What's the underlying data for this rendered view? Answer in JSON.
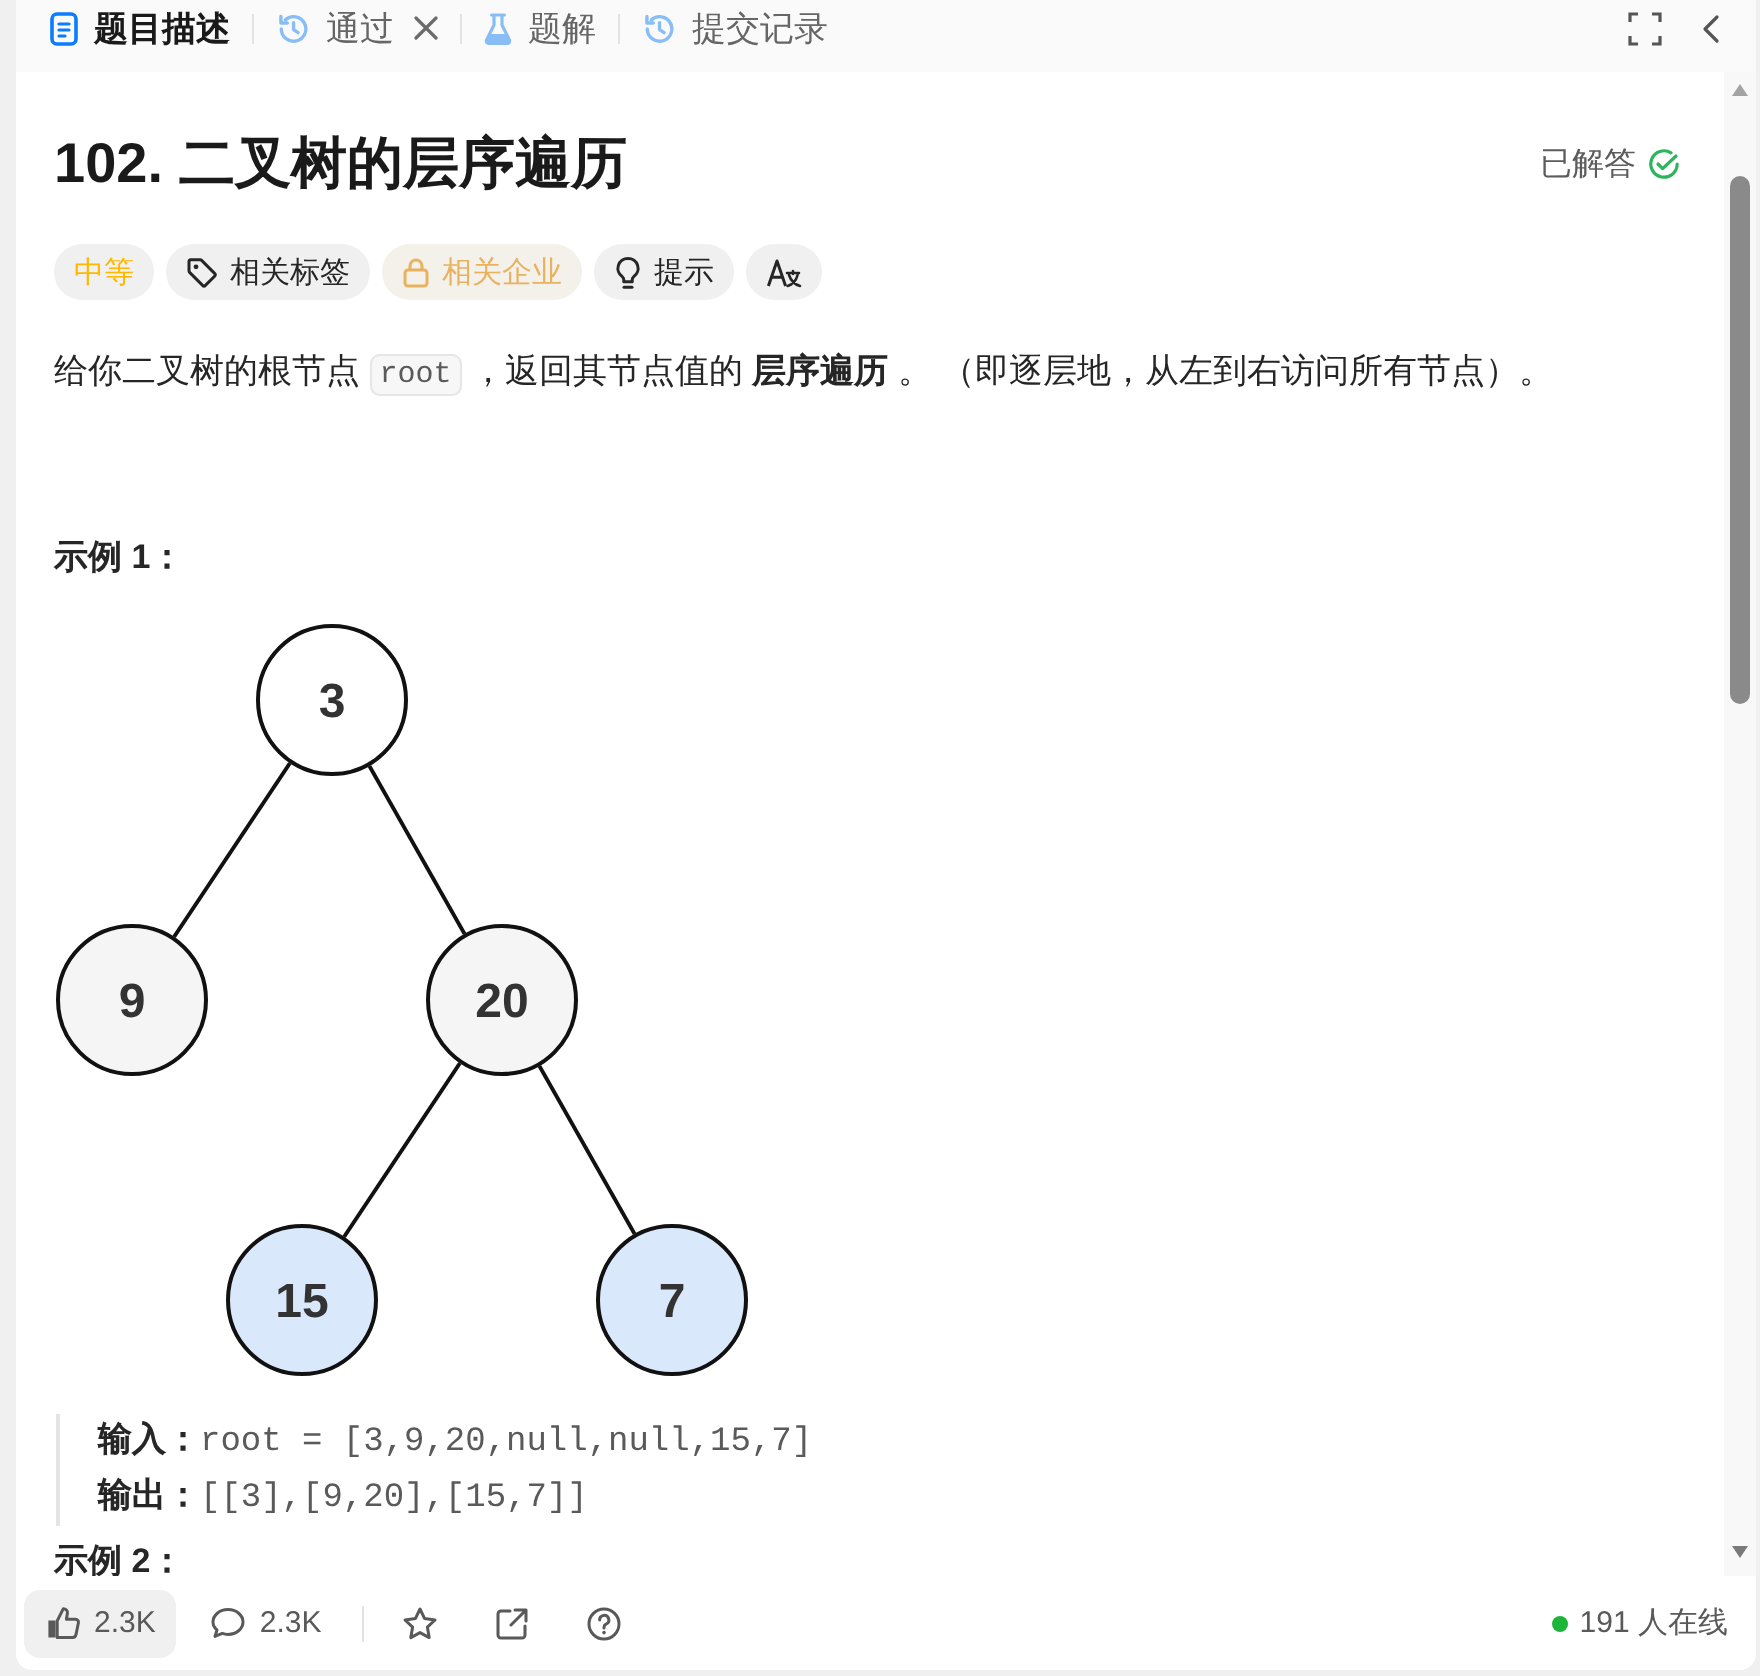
{
  "tabs": [
    {
      "kind": "description",
      "label": "题目描述",
      "selected": true,
      "closable": false
    },
    {
      "kind": "result",
      "label": "通过",
      "selected": false,
      "closable": true
    },
    {
      "kind": "solutions",
      "label": "题解",
      "selected": false,
      "closable": false
    },
    {
      "kind": "submissions",
      "label": "提交记录",
      "selected": false,
      "closable": false
    }
  ],
  "problem": {
    "title": "102. 二叉树的层序遍历",
    "status": "已解答"
  },
  "tags": [
    {
      "kind": "difficulty",
      "label": "中等"
    },
    {
      "kind": "topics",
      "label": "相关标签"
    },
    {
      "kind": "companies",
      "label": "相关企业"
    },
    {
      "kind": "hint",
      "label": "提示"
    },
    {
      "kind": "translate"
    }
  ],
  "description": [
    {
      "kind": "text",
      "text": "给你二叉树的根节点 "
    },
    {
      "kind": "code",
      "text": "root"
    },
    {
      "kind": "text",
      "text": " ，返回其节点值的 **层序遍历** 。 （即逐层地，从左到右访问所有节点）。"
    }
  ],
  "examples": [
    {
      "title": "示例 1：",
      "tree": {
        "value": "3",
        "color": "#ffffff",
        "children": [
          {
            "value": "9",
            "color": "#f5f5f5"
          },
          {
            "value": "20",
            "color": "#f5f5f5",
            "children": [
              {
                "value": "15",
                "color": "#dae8fc"
              },
              {
                "value": "7",
                "color": "#dae8fc"
              }
            ]
          }
        ]
      },
      "lines": [
        {
          "label": "输入：",
          "value": "root = [3,9,20,null,null,15,7]"
        },
        {
          "label": "输出：",
          "value": "[[3],[9,20],[15,7]]"
        }
      ]
    },
    {
      "title": "示例 2："
    }
  ],
  "footer": {
    "likes": "2.3K",
    "comments": "2.3K",
    "online": "191 人在线"
  }
}
